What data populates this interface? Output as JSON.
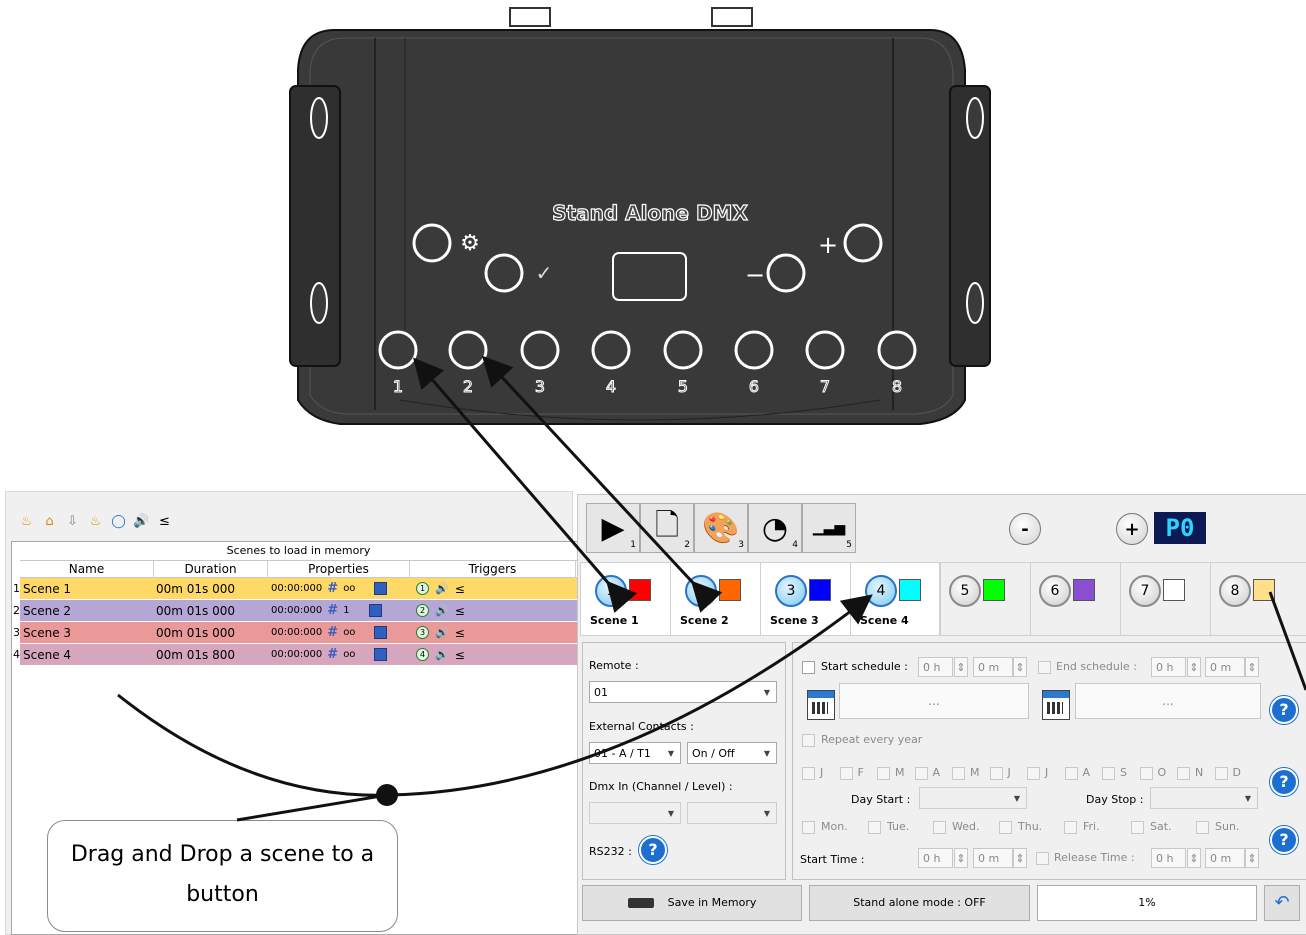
{
  "device": {
    "label": "Stand Alone DMX",
    "buttons": [
      "1",
      "2",
      "3",
      "4",
      "5",
      "6",
      "7",
      "8"
    ],
    "plus": "+",
    "minus": "−",
    "check": "✓"
  },
  "scene_panel": {
    "toolbar_icons": [
      "scenes-icon",
      "home-icon",
      "down-arrow-icon",
      "effects-icon",
      "circle-icon",
      "sound-icon",
      "fader-icon"
    ],
    "table_title": "Scenes to load in memory",
    "columns": [
      "Name",
      "Duration",
      "Properties",
      "Triggers"
    ],
    "rows": [
      {
        "num": "1",
        "name": "Scene 1",
        "duration": "00m 01s 000",
        "time": "00:00:000",
        "loop": "oo",
        "trig": "1",
        "color": "#ffd966"
      },
      {
        "num": "2",
        "name": "Scene 2",
        "duration": "00m 01s 000",
        "time": "00:00:000",
        "loop": "1",
        "trig": "2",
        "color": "#b4a7d6"
      },
      {
        "num": "3",
        "name": "Scene 3",
        "duration": "00m 01s 000",
        "time": "00:00:000",
        "loop": "oo",
        "trig": "3",
        "color": "#ea9999"
      },
      {
        "num": "4",
        "name": "Scene 4",
        "duration": "00m 01s 800",
        "time": "00:00:000",
        "loop": "oo",
        "trig": "4",
        "color": "#d5a6bd"
      }
    ]
  },
  "controller": {
    "mode_tabs": [
      {
        "icon": "play-icon",
        "num": "1"
      },
      {
        "icon": "page-icon",
        "num": "2"
      },
      {
        "icon": "palette-icon",
        "num": "3"
      },
      {
        "icon": "speed-icon",
        "num": "4"
      },
      {
        "icon": "level-icon",
        "num": "5"
      }
    ],
    "minus_label": "-",
    "plus_label": "+",
    "display": "P0",
    "slots": [
      {
        "num": "1",
        "color": "#ff0000",
        "label": "Scene 1",
        "active": true
      },
      {
        "num": "2",
        "color": "#ff6600",
        "label": "Scene 2",
        "active": true
      },
      {
        "num": "3",
        "color": "#0000ff",
        "label": "Scene 3",
        "active": true
      },
      {
        "num": "4",
        "color": "#00ffff",
        "label": "Scene 4",
        "active": true
      },
      {
        "num": "5",
        "color": "#00ff00",
        "label": "",
        "active": false
      },
      {
        "num": "6",
        "color": "#8a4fd1",
        "label": "",
        "active": false
      },
      {
        "num": "7",
        "color": "#ffffff",
        "label": "",
        "active": false
      },
      {
        "num": "8",
        "color": "#ffe08a",
        "label": "",
        "active": false
      }
    ],
    "remote_label": "Remote :",
    "remote_value": "01",
    "external_label": "External Contacts :",
    "external_value": "01 - A / T1",
    "onoff_value": "On / Off",
    "dmxin_label": "Dmx In (Channel / Level) :",
    "rs232_label": "RS232 :",
    "start_schedule": "Start schedule :",
    "end_schedule": "End schedule :",
    "hour": "0 h",
    "minute": "0 m",
    "ellipsis": "...",
    "repeat_label": "Repeat every year",
    "months": [
      "J",
      "F",
      "M",
      "A",
      "M",
      "J",
      "J",
      "A",
      "S",
      "O",
      "N",
      "D"
    ],
    "day_start": "Day Start :",
    "day_stop": "Day Stop :",
    "weekdays": [
      "Mon.",
      "Tue.",
      "Wed.",
      "Thu.",
      "Fri.",
      "Sat.",
      "Sun."
    ],
    "start_time": "Start Time :",
    "release_time": "Release Time :",
    "save_label": "Save in Memory",
    "standalone_label": "Stand alone mode : OFF",
    "progress": "1%",
    "help": "?",
    "undo_icon": "undo-icon"
  },
  "callout": "Drag and Drop a scene to a button"
}
